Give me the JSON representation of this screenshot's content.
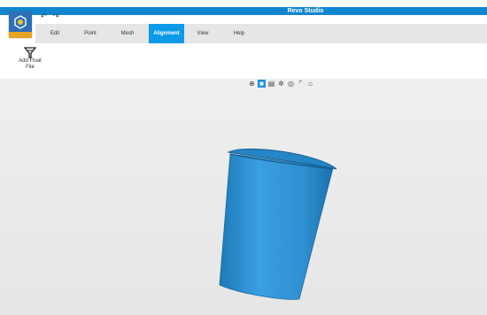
{
  "app": {
    "title": "Revo Studio"
  },
  "quick_access": {
    "undo": "↶",
    "redo": "↷"
  },
  "menu": {
    "tabs": [
      {
        "label": "Edit"
      },
      {
        "label": "Point"
      },
      {
        "label": "Mesh"
      },
      {
        "label": "Alignment",
        "active": true
      },
      {
        "label": "View"
      },
      {
        "label": "Help"
      }
    ]
  },
  "ribbon": {
    "add_float_label_line1": "Add Float",
    "add_float_label_line2": "File"
  },
  "view_tools": [
    {
      "icon": "crosshair-icon",
      "glyph": "⊕"
    },
    {
      "icon": "cube-solid-icon",
      "glyph": "■",
      "active": true
    },
    {
      "icon": "cube-wire-icon",
      "glyph": "▤"
    },
    {
      "icon": "light-icon",
      "glyph": "✲"
    },
    {
      "icon": "target-icon",
      "glyph": "◎"
    },
    {
      "icon": "frame-icon",
      "glyph": "⌜"
    },
    {
      "icon": "chat-icon",
      "glyph": "⌂"
    }
  ],
  "colors": {
    "accent": "#0d9be8",
    "model": "#2f8fd0",
    "titlebar": "#0f86cf"
  }
}
